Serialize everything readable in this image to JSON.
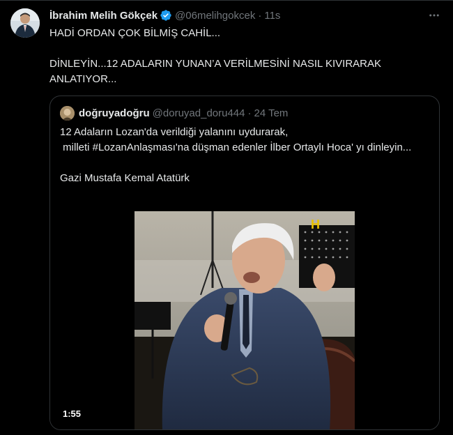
{
  "tweet": {
    "author_name": "İbrahim Melih Gökçek",
    "handle": "@06melihgokcek",
    "separator": "·",
    "time": "11s",
    "text": "HADİ ORDAN ÇOK BİLMİŞ CAHİL...\n\nDİNLEYİN...12 ADALARIN YUNAN’A VERİLMESİNİ NASIL KIVIRARAK ANLATIYOR...",
    "more_icon": "more-horizontal-icon",
    "verified_icon": "verified-badge-icon",
    "verified_color": "#1d9bf0"
  },
  "quoted": {
    "author_name": "doğruyadoğru",
    "handle": "@doruyad_doru444",
    "separator": "·",
    "date": "24 Tem",
    "text": "12 Adaların Lozan'da verildiği yalanını uydurarak,\n milleti #LozanAnlaşması'na düşman edenler İlber Ortaylı Hoca' yı dinleyin...\n\nGazi Mustafa Kemal Atatürk",
    "video_duration": "1:55",
    "watermark": "H"
  }
}
